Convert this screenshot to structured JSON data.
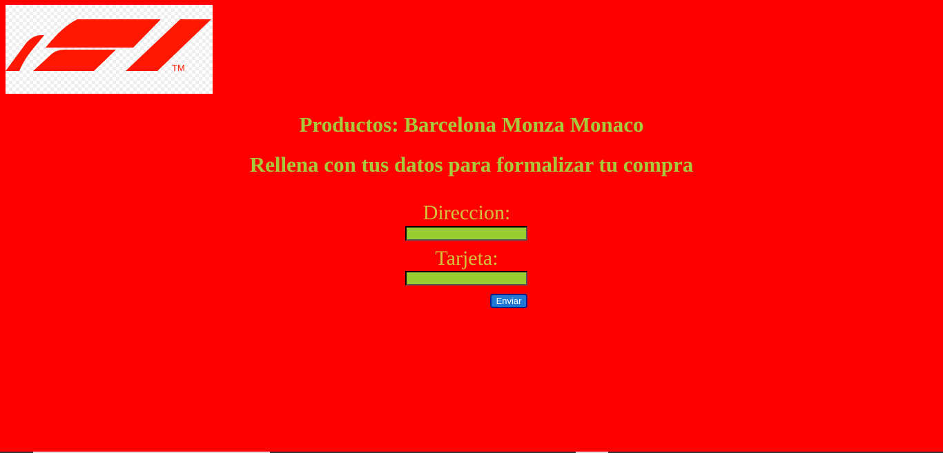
{
  "logo": {
    "icon": "f1-logo-icon",
    "text": "F1",
    "trademark": "TM",
    "color": "#ff1801"
  },
  "headings": {
    "products": "Productos: Barcelona Monza Monaco",
    "instructions": "Rellena con tus datos para formalizar tu compra"
  },
  "form": {
    "address_label": "Direccion:",
    "address_value": "",
    "card_label": "Tarjeta:",
    "card_value": "",
    "submit_label": "Enviar"
  },
  "colors": {
    "background": "#ff0000",
    "heading": "#a8c93a",
    "label": "#d4c23a",
    "input_background": "#9acd32",
    "button": "#1f78d1"
  }
}
